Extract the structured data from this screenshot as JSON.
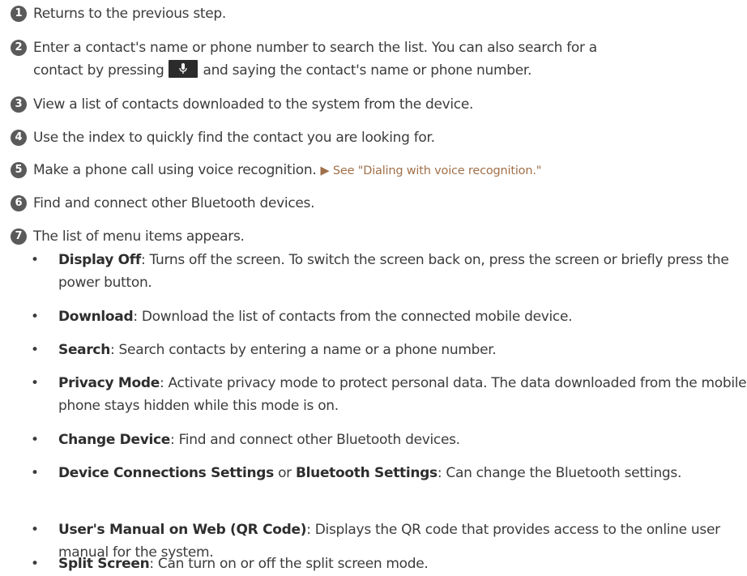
{
  "items": [
    {
      "num": "1",
      "text": "Returns to the previous step."
    },
    {
      "num": "2",
      "line1": "Enter a contact's name or phone number to search the list. You can also search for a",
      "line2_pre": "contact by pressing",
      "line2_post": "and saying the contact's name or phone number.",
      "icon": "microphone-icon"
    },
    {
      "num": "3",
      "text": "View a list of contacts downloaded to the system from the device."
    },
    {
      "num": "4",
      "text": "Use the index to quickly find the contact you are looking for."
    },
    {
      "num": "5",
      "text": "Make a phone call using voice recognition.",
      "ref": "▶ See \"Dialing with voice recognition.\""
    },
    {
      "num": "6",
      "text": "Find and connect other Bluetooth devices."
    },
    {
      "num": "7",
      "text": "The list of menu items appears."
    }
  ],
  "menu": [
    {
      "term": "Display Off",
      "desc": ": Turns off the screen. To switch the screen back on, press the screen or briefly press the power button."
    },
    {
      "term": "Download",
      "desc": ": Download the list of contacts from the connected mobile device."
    },
    {
      "term": "Search",
      "desc": ": Search contacts by entering a name or a phone number."
    },
    {
      "term": "Privacy Mode",
      "desc": ": Activate privacy mode to protect personal data. The data downloaded from the mobile phone stays hidden while this mode is on."
    },
    {
      "term": "Change Device",
      "desc": ": Find and connect other Bluetooth devices."
    },
    {
      "term": "Device Connections Settings",
      "mid": " or ",
      "term2": "Bluetooth Settings",
      "desc": ": Can change the Bluetooth settings."
    },
    {
      "term": "User's Manual on Web (QR Code)",
      "desc": ": Displays the QR code that provides access to the online user manual for the system."
    },
    {
      "term": "Split Screen",
      "desc": ": Can turn on or off the split screen mode."
    }
  ],
  "bullet": "•"
}
